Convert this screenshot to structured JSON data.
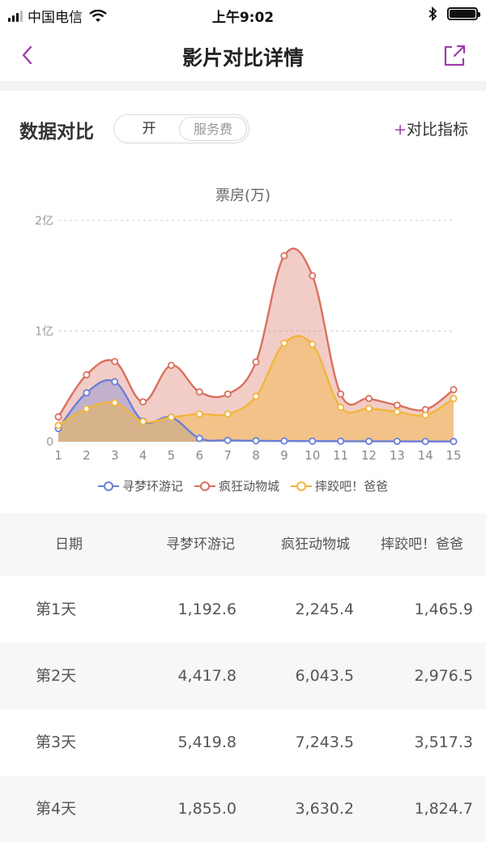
{
  "status_bar": {
    "carrier": "中国电信",
    "time": "上午9:02"
  },
  "nav": {
    "title": "影片对比详情",
    "back_icon": "chevron-left-icon",
    "share_icon": "share-icon"
  },
  "controls": {
    "section_title": "数据对比",
    "toggle_on_label": "开",
    "toggle_option_label": "服务费",
    "add_metric_label": "对比指标",
    "add_metric_prefix": "+"
  },
  "colors": {
    "accent": "#9b3fa8",
    "series1": "#6a7fd8",
    "series2": "#d9705e",
    "series3": "#f1b53c"
  },
  "chart_data": {
    "type": "area",
    "title": "票房(万)",
    "x": [
      1,
      2,
      3,
      4,
      5,
      6,
      7,
      8,
      9,
      10,
      11,
      12,
      13,
      14,
      15
    ],
    "y_ticks": [
      {
        "label": "0",
        "value": 0
      },
      {
        "label": "1亿",
        "value": 10000
      },
      {
        "label": "2亿",
        "value": 20000
      }
    ],
    "ylim": [
      0,
      20000
    ],
    "grid": true,
    "legend_position": "bottom",
    "series": [
      {
        "name": "寻梦环游记",
        "values": [
          1192.6,
          4417.8,
          5419.8,
          1855,
          2200,
          300,
          120,
          80,
          60,
          50,
          40,
          30,
          30,
          20,
          20
        ]
      },
      {
        "name": "疯狂动物城",
        "values": [
          2245.4,
          6043.5,
          7243.5,
          3600,
          6900,
          4500,
          4300,
          7200,
          16800,
          15000,
          4300,
          3900,
          3300,
          2900,
          4700
        ]
      },
      {
        "name": "摔跤吧！爸爸",
        "values": [
          1465.9,
          2976.5,
          3517.3,
          1824.7,
          2200,
          2500,
          2500,
          4100,
          8900,
          8800,
          3100,
          3000,
          2700,
          2400,
          3900
        ]
      }
    ]
  },
  "table": {
    "headers": [
      "日期",
      "寻梦环游记",
      "疯狂动物城",
      "摔跤吧！爸爸"
    ],
    "rows": [
      {
        "date": "第1天",
        "v1": "1,192.6",
        "v2": "2,245.4",
        "v3": "1,465.9"
      },
      {
        "date": "第2天",
        "v1": "4,417.8",
        "v2": "6,043.5",
        "v3": "2,976.5"
      },
      {
        "date": "第3天",
        "v1": "5,419.8",
        "v2": "7,243.5",
        "v3": "3,517.3"
      },
      {
        "date": "第4天",
        "v1": "1,855.0",
        "v2": "3,630.2",
        "v3": "1,824.7"
      }
    ]
  }
}
